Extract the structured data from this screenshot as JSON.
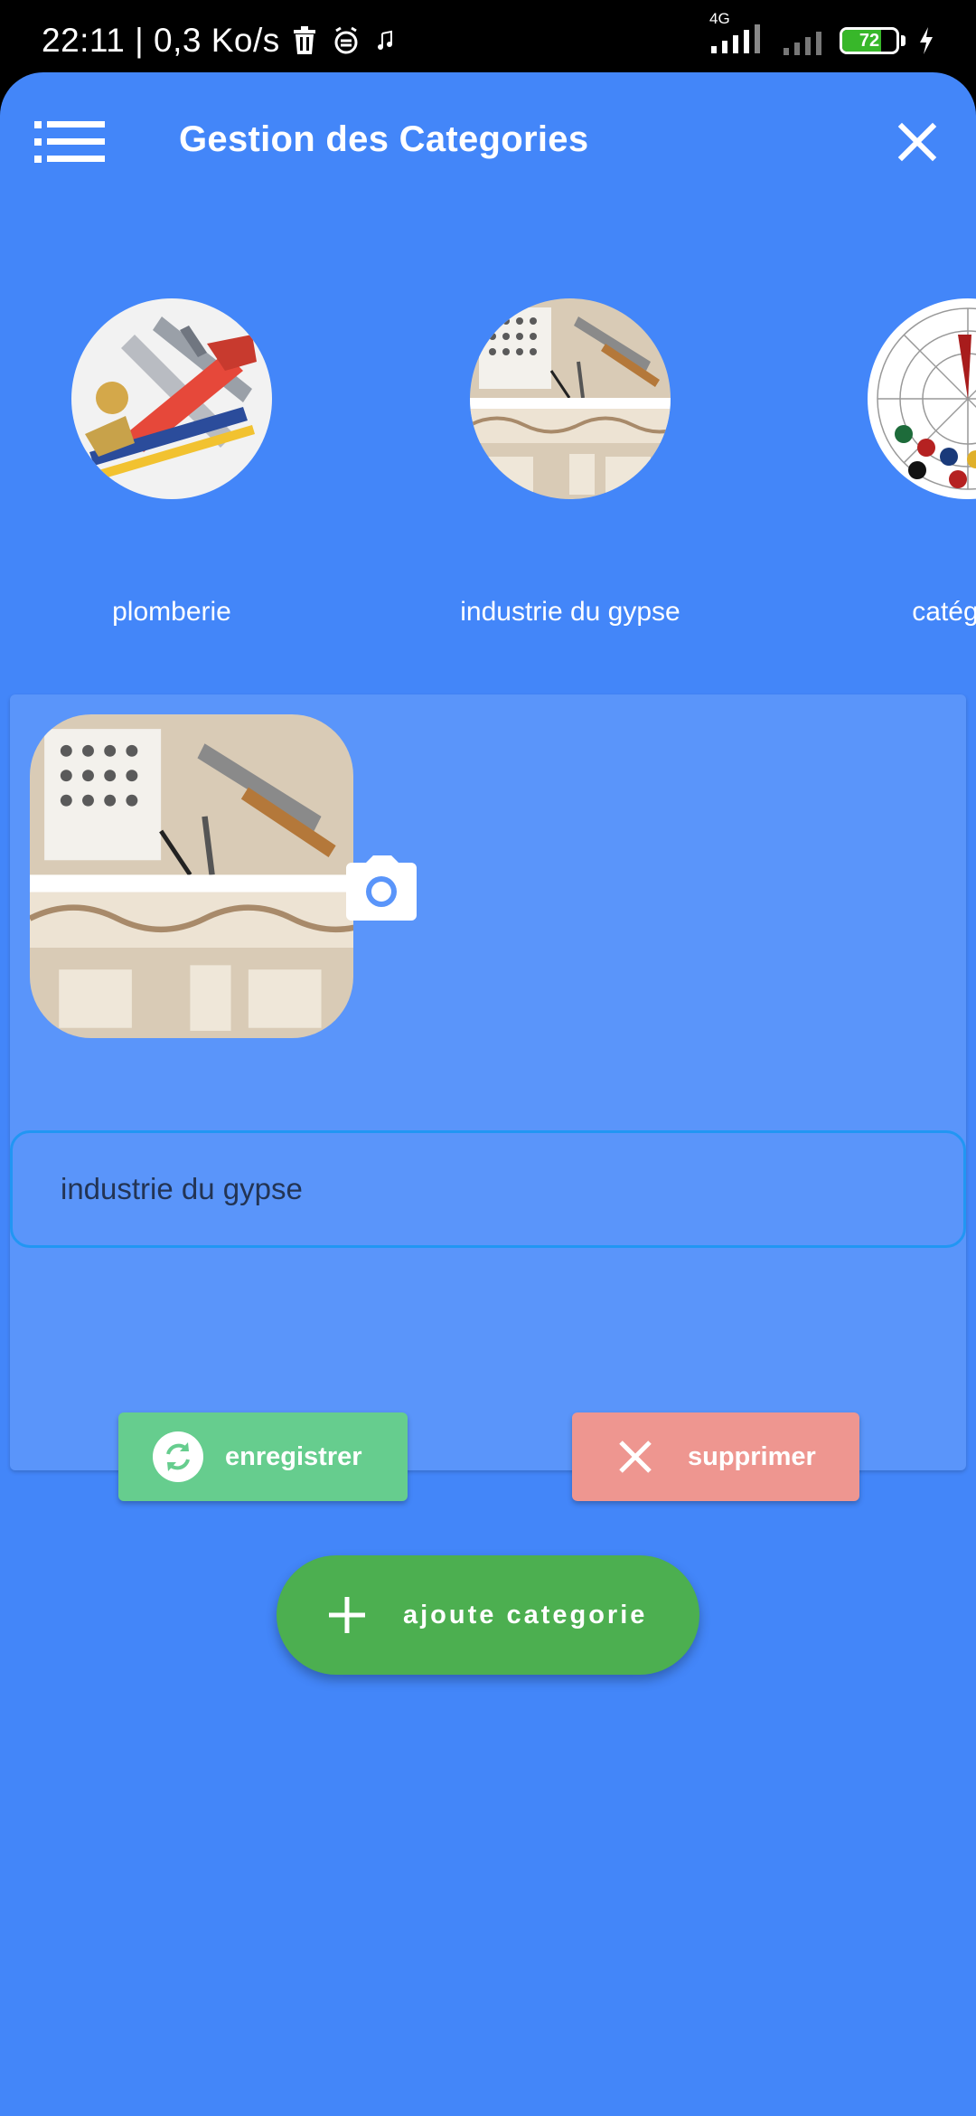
{
  "status_bar": {
    "time": "22:11 | 0,3 Ko/s",
    "network": "4G",
    "battery": "72",
    "battery_level": 0.72,
    "icons": [
      "trash-icon",
      "alarm-icon",
      "music-note-icon",
      "signal-icon",
      "charging-icon"
    ]
  },
  "app_bar": {
    "title": "Gestion des Categories",
    "menu_icon": "list-icon",
    "close_icon": "close-icon"
  },
  "categories": [
    {
      "name": "plomberie",
      "image": "plumbing-tools-image"
    },
    {
      "name": "industrie du gypse",
      "image": "gypsum-carving-image"
    },
    {
      "name": "catégorie",
      "image": "zellige-tile-image"
    }
  ],
  "editor": {
    "image": "gypsum-carving-image",
    "camera_icon": "camera-icon",
    "name_value": "industrie du gypse",
    "save_label": "enregistrer",
    "save_icon": "refresh-icon",
    "delete_label": "supprimer",
    "delete_icon": "close-icon"
  },
  "fab": {
    "label": "ajoute categorie",
    "icon": "plus-icon"
  },
  "colors": {
    "background": "#4386f9",
    "card": "#5a95fa",
    "input_border": "#2196f3",
    "save_button": "#66cd8e",
    "delete_button": "#ee9690",
    "fab": "#4caf50"
  }
}
